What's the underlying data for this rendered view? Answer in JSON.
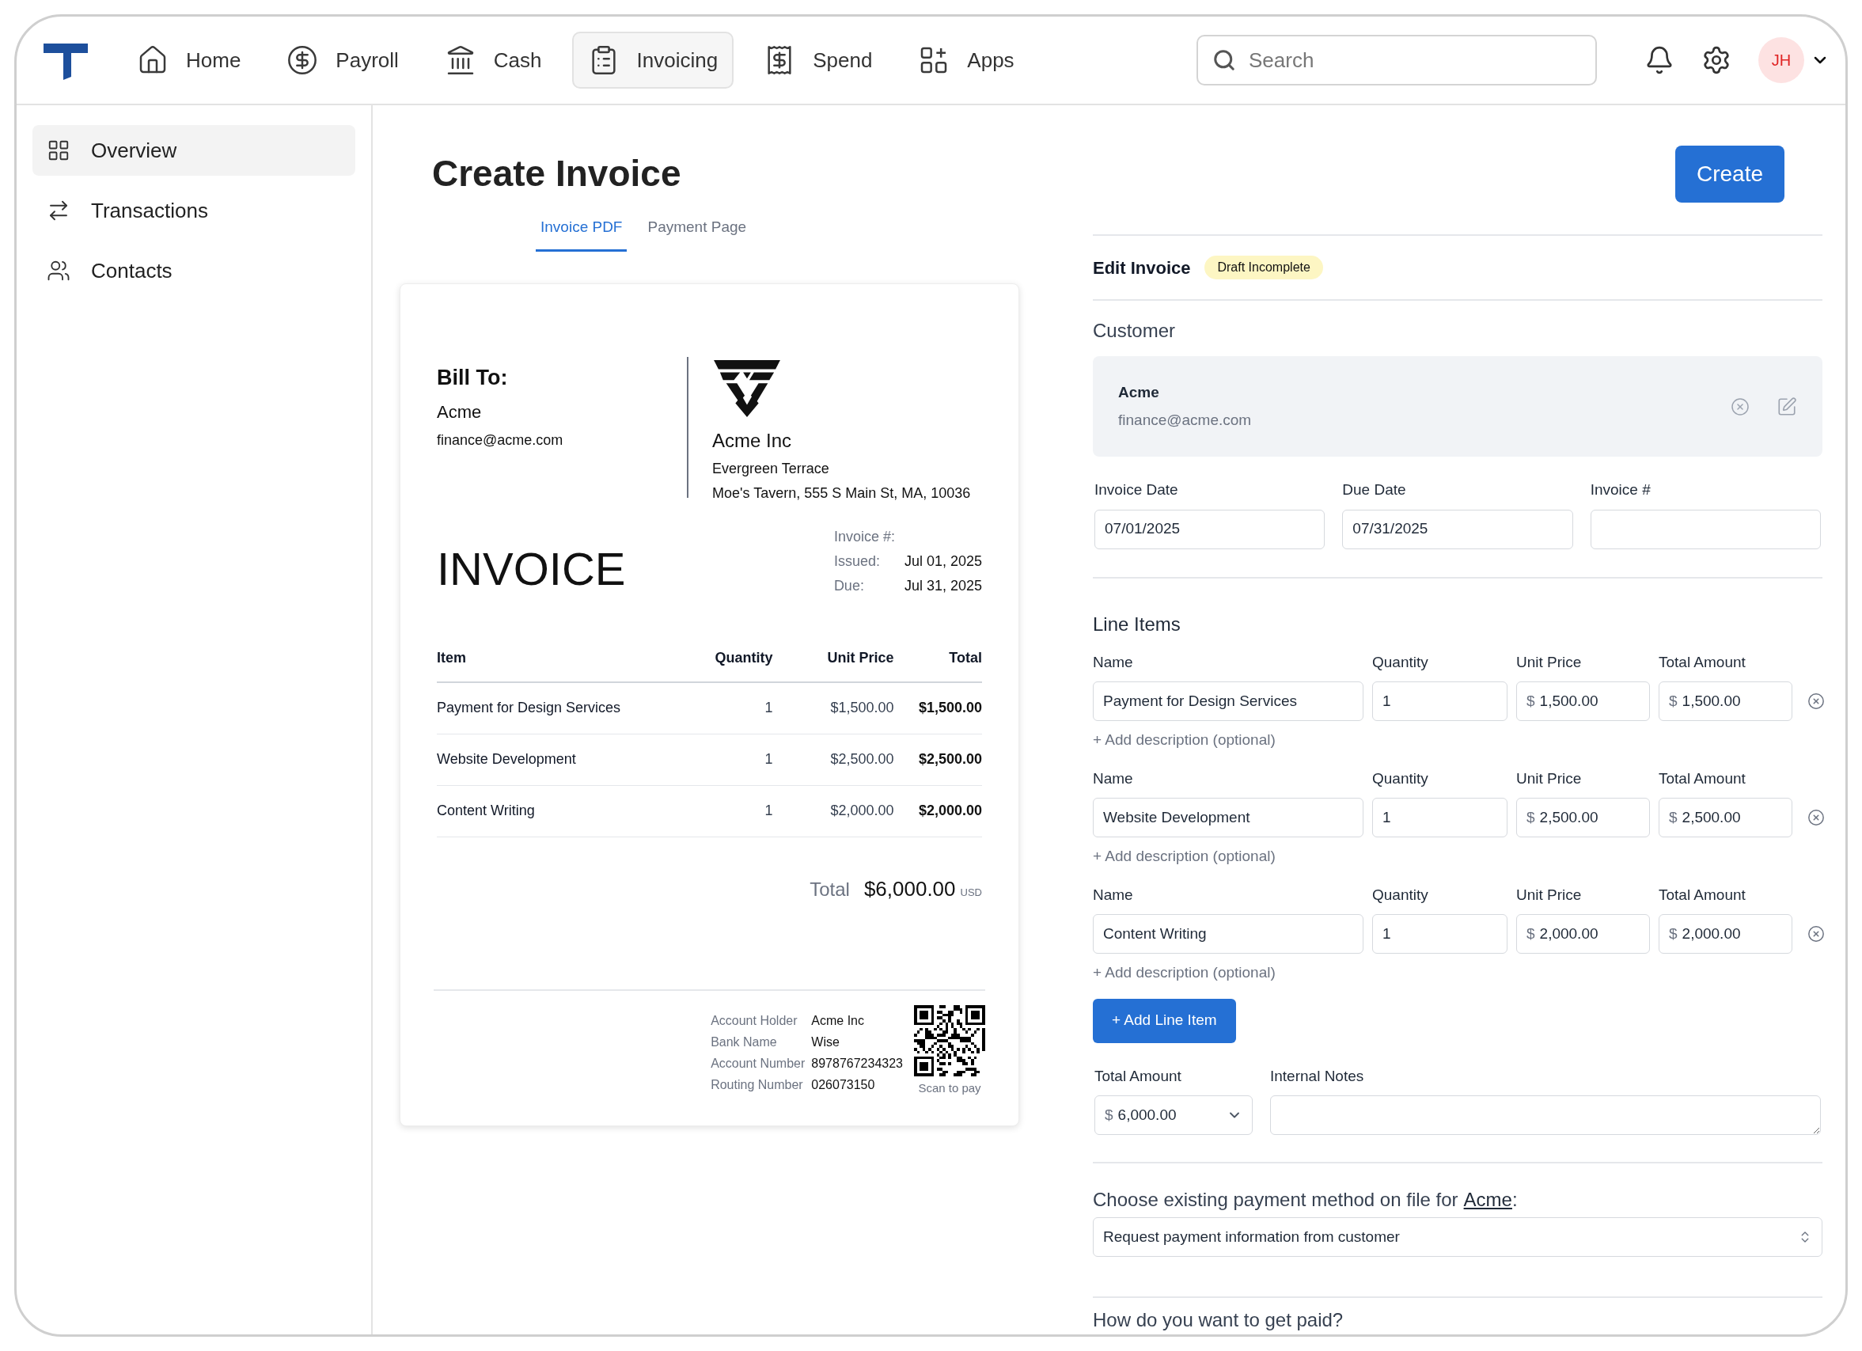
{
  "nav": {
    "items": [
      {
        "label": "Home",
        "selected": false
      },
      {
        "label": "Payroll",
        "selected": false
      },
      {
        "label": "Cash",
        "selected": false
      },
      {
        "label": "Invoicing",
        "selected": true
      },
      {
        "label": "Spend",
        "selected": false
      },
      {
        "label": "Apps",
        "selected": false
      }
    ],
    "search": {
      "placeholder": "Search"
    },
    "avatar": {
      "initials": "JH"
    }
  },
  "sidebar": {
    "items": [
      {
        "label": "Overview",
        "selected": true
      },
      {
        "label": "Transactions",
        "selected": false
      },
      {
        "label": "Contacts",
        "selected": false
      }
    ]
  },
  "page": {
    "title": "Create Invoice",
    "create_button": "Create"
  },
  "tabs": [
    {
      "label": "Invoice PDF",
      "selected": true
    },
    {
      "label": "Payment Page",
      "selected": false
    }
  ],
  "invoice_pdf": {
    "bill_to": {
      "heading": "Bill To:",
      "name": "Acme",
      "email": "finance@acme.com"
    },
    "company": {
      "name": "Acme Inc",
      "address_lines": [
        "Evergreen Terrace",
        "Moe's Tavern, 555 S Main St, MA, 10036"
      ]
    },
    "title": "INVOICE",
    "meta": [
      {
        "label": "Invoice #:"
      },
      {
        "label": "Issued:",
        "value": "Jul 01, 2025"
      },
      {
        "label": "Due:",
        "value": "Jul 31, 2025"
      }
    ],
    "table": {
      "columns": [
        "Item",
        "Quantity",
        "Unit Price",
        "Total"
      ],
      "rows": [
        [
          "Payment for Design Services",
          "1",
          "$1,500.00",
          "$1,500.00"
        ],
        [
          "Website Development",
          "1",
          "$2,500.00",
          "$2,500.00"
        ],
        [
          "Content Writing",
          "1",
          "$2,000.00",
          "$2,000.00"
        ]
      ]
    },
    "total": {
      "label": "Total",
      "amount": "$6,000.00",
      "currency": "USD"
    },
    "bank": [
      {
        "label": "Account Holder",
        "value": "Acme Inc"
      },
      {
        "label": "Bank Name",
        "value": "Wise"
      },
      {
        "label": "Account Number",
        "value": "8978767234323"
      },
      {
        "label": "Routing Number",
        "value": "026073150"
      }
    ],
    "qr_caption": "Scan to pay"
  },
  "edit_panel": {
    "title": "Edit Invoice",
    "status_badge": "Draft Incomplete",
    "customer": {
      "heading": "Customer",
      "name": "Acme",
      "email": "finance@acme.com"
    },
    "fields": [
      {
        "label": "Invoice Date",
        "value": "07/01/2025"
      },
      {
        "label": "Due Date",
        "value": "07/31/2025"
      },
      {
        "label": "Invoice #"
      }
    ],
    "line_items_heading": "Line Items",
    "line_items": [
      {
        "labels": [
          "Name",
          "Quantity",
          "Unit Price",
          "Total Amount"
        ],
        "name": "Payment for Design Services",
        "quantity": "1",
        "currency": "$",
        "unit_price": "1,500.00",
        "total": "1,500.00",
        "add_description": "+ Add description (optional)"
      },
      {
        "labels": [
          "Name",
          "Quantity",
          "Unit Price",
          "Total Amount"
        ],
        "name": "Website Development",
        "quantity": "1",
        "currency": "$",
        "unit_price": "2,500.00",
        "total": "2,500.00",
        "add_description": "+ Add description (optional)"
      },
      {
        "labels": [
          "Name",
          "Quantity",
          "Unit Price",
          "Total Amount"
        ],
        "name": "Content Writing",
        "quantity": "1",
        "currency": "$",
        "unit_price": "2,000.00",
        "total": "2,000.00",
        "add_description": "+ Add description (optional)"
      }
    ],
    "add_line_item_button": "+ Add Line Item",
    "total_amount": {
      "label": "Total Amount",
      "currency": "$",
      "value": "6,000.00"
    },
    "internal_notes": {
      "label": "Internal Notes"
    },
    "payment_method": {
      "prompt": "Choose existing payment method on file for",
      "customer_link": "Acme",
      "suffix": ":",
      "value": "Request payment information from customer"
    },
    "get_paid_heading": "How do you want to get paid?"
  }
}
